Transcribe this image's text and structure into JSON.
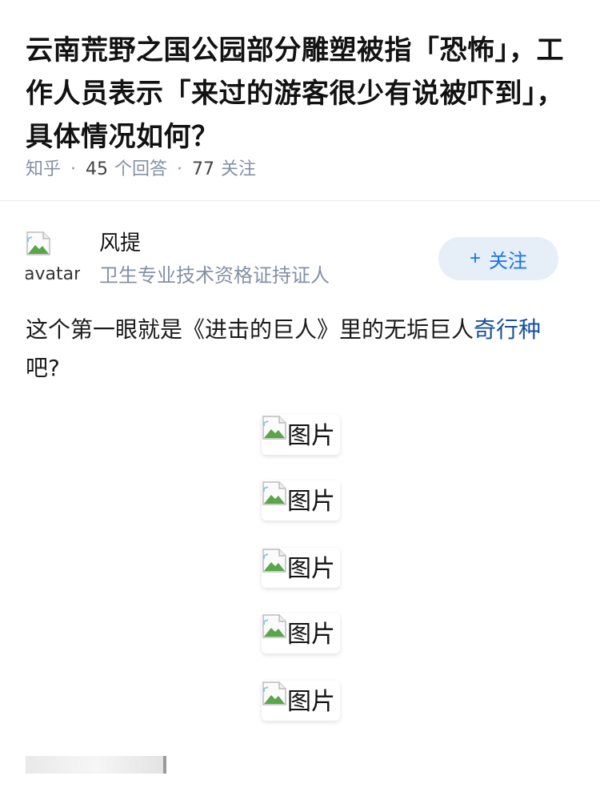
{
  "question": {
    "title": "云南荒野之国公园部分雕塑被指「恐怖」，工作人员表示「来过的游客很少有说被吓到」，具体情况如何？",
    "source": "知乎",
    "answer_count": "45",
    "answer_label": "个回答",
    "follow_count": "77",
    "follow_label": "关注"
  },
  "author": {
    "avatar_alt": "avatar",
    "name": "风提",
    "description": "卫生专业技术资格证持证人",
    "follow_button": "关注",
    "follow_icon": "plus-icon"
  },
  "answer": {
    "text_before": "这个第一眼就是《进击的巨人》里的无垢巨人",
    "link_text": "奇行种",
    "text_after": "吧?"
  },
  "images": [
    {
      "alt": "图片"
    },
    {
      "alt": "图片"
    },
    {
      "alt": "图片"
    },
    {
      "alt": "图片"
    },
    {
      "alt": "图片"
    }
  ],
  "colors": {
    "accent": "#1772f6",
    "link": "#175199",
    "meta": "#8590a6",
    "button_bg": "#e6eef8"
  }
}
